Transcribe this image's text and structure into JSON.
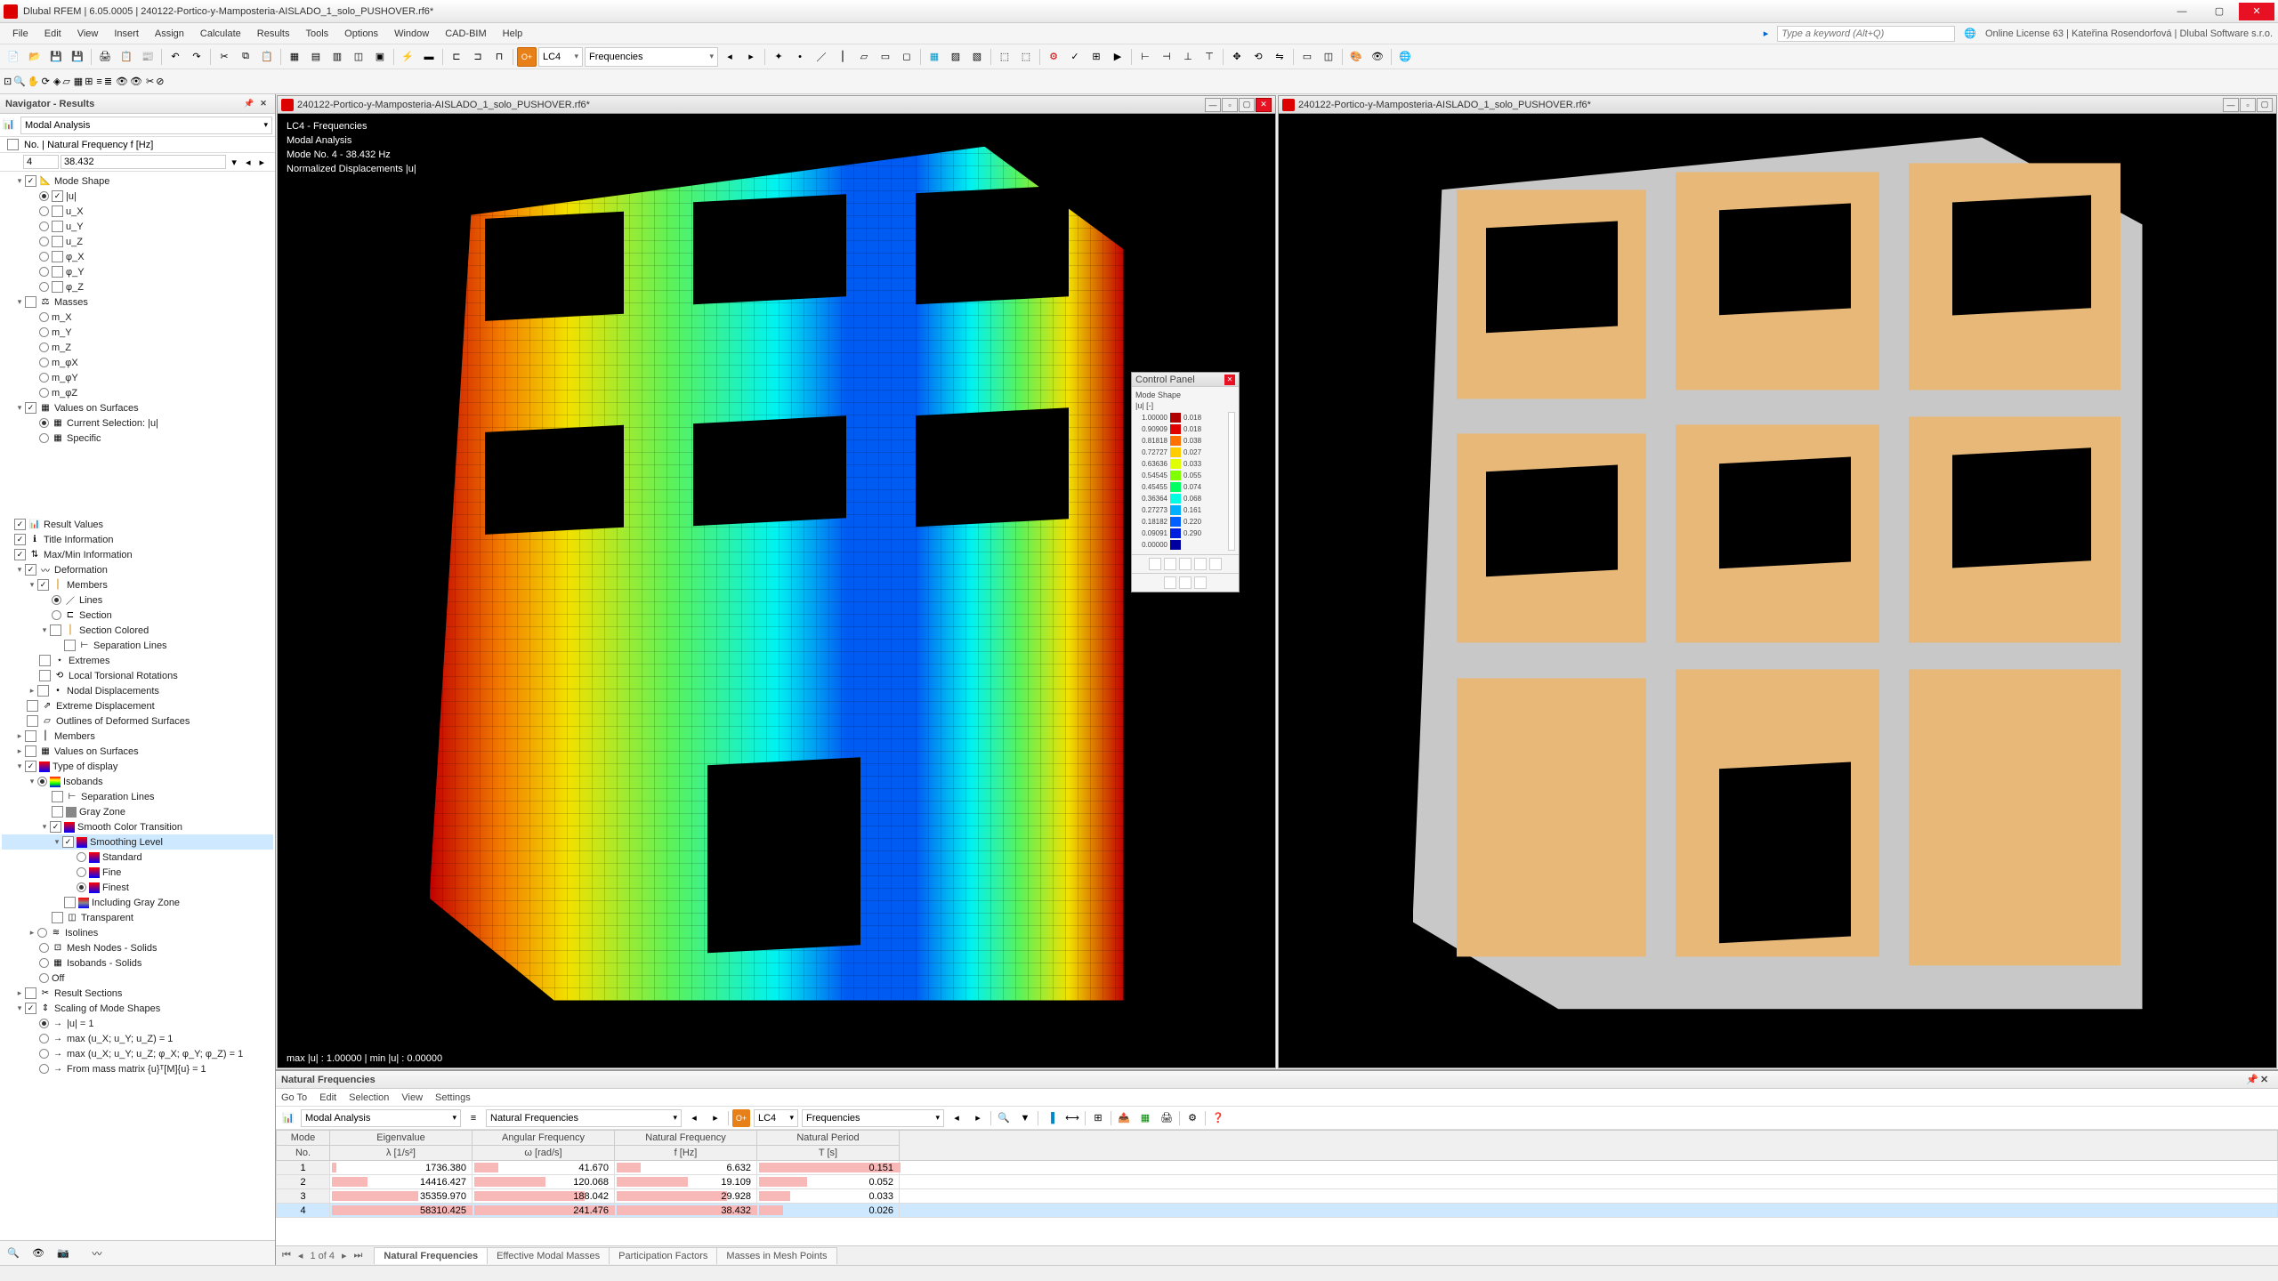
{
  "app": {
    "title": "Dlubal RFEM | 6.05.0005 | 240122-Portico-y-Mamposteria-AISLADO_1_solo_PUSHOVER.rf6*",
    "license": "Online License 63 | Kateřina Rosendorfová | Dlubal Software s.r.o."
  },
  "menus": [
    "File",
    "Edit",
    "View",
    "Insert",
    "Assign",
    "Calculate",
    "Results",
    "Tools",
    "Options",
    "Window",
    "CAD-BIM",
    "Help"
  ],
  "search_placeholder": "Type a keyword (Alt+Q)",
  "toolbar1_combo1": "LC4",
  "toolbar1_combo2": "Frequencies",
  "nav": {
    "title": "Navigator - Results",
    "combo": "Modal Analysis",
    "freq_hdr": "No. | Natural Frequency f [Hz]",
    "freq_no": "4",
    "freq_val": "38.432",
    "mode_shape": "Mode Shape",
    "items_u": [
      "|u|",
      "u_X",
      "u_Y",
      "u_Z",
      "φ_X",
      "φ_Y",
      "φ_Z"
    ],
    "masses": "Masses",
    "items_m": [
      "m_X",
      "m_Y",
      "m_Z",
      "m_φX",
      "m_φY",
      "m_φZ"
    ],
    "values_on_surfaces": "Values on Surfaces",
    "current_selection": "Current Selection: |u|",
    "specific": "Specific",
    "result_values": "Result Values",
    "title_information": "Title Information",
    "maxmin": "Max/Min Information",
    "deformation": "Deformation",
    "members": "Members",
    "lines": "Lines",
    "section": "Section",
    "section_colored": "Section Colored",
    "separation_lines": "Separation Lines",
    "extremes": "Extremes",
    "local_torsional": "Local Torsional Rotations",
    "nodal_disp": "Nodal Displacements",
    "extreme_disp": "Extreme Displacement",
    "outlines_deformed": "Outlines of Deformed Surfaces",
    "members2": "Members",
    "vos2": "Values on Surfaces",
    "type_display": "Type of display",
    "isobands": "Isobands",
    "sep_lines2": "Separation Lines",
    "gray_zone": "Gray Zone",
    "smooth_ct": "Smooth Color Transition",
    "smoothing_level": "Smoothing Level",
    "standard": "Standard",
    "fine": "Fine",
    "finest": "Finest",
    "incl_gray": "Including Gray Zone",
    "transparent": "Transparent",
    "isolines": "Isolines",
    "mesh_nodes_solids": "Mesh Nodes - Solids",
    "isobands_solids": "Isobands - Solids",
    "off": "Off",
    "result_sections": "Result Sections",
    "scaling": "Scaling of Mode Shapes",
    "scale_u1": "|u| = 1",
    "scale_max1": "max (u_X; u_Y; u_Z) = 1",
    "scale_max2": "max (u_X; u_Y; u_Z; φ_X; φ_Y; φ_Z) = 1",
    "scale_mass": "From mass matrix {u}ᵀ[M]{u} = 1"
  },
  "view": {
    "file": "240122-Portico-y-Mamposteria-AISLADO_1_solo_PUSHOVER.rf6*",
    "info1": "LC4 - Frequencies",
    "info2": "Modal Analysis",
    "info3": "Mode No. 4 - 38.432 Hz",
    "info4": "Normalized Displacements |u|",
    "status": "max |u| : 1.00000 | min |u| : 0.00000"
  },
  "ctrl_panel": {
    "title": "Control Panel",
    "sub1": "Mode Shape",
    "sub2": "|u| [-]",
    "rows": [
      {
        "v": "1.00000",
        "c": "#b00000",
        "v2": "0.018"
      },
      {
        "v": "0.90909",
        "c": "#e00000",
        "v2": "0.018"
      },
      {
        "v": "0.81818",
        "c": "#ff7000",
        "v2": "0.038"
      },
      {
        "v": "0.72727",
        "c": "#ffcc00",
        "v2": "0.027"
      },
      {
        "v": "0.63636",
        "c": "#e0ff00",
        "v2": "0.033"
      },
      {
        "v": "0.54545",
        "c": "#80ff00",
        "v2": "0.055"
      },
      {
        "v": "0.45455",
        "c": "#00ff60",
        "v2": "0.074"
      },
      {
        "v": "0.36364",
        "c": "#00ffe0",
        "v2": "0.068"
      },
      {
        "v": "0.27273",
        "c": "#00b0ff",
        "v2": "0.161"
      },
      {
        "v": "0.18182",
        "c": "#0060ff",
        "v2": "0.220"
      },
      {
        "v": "0.09091",
        "c": "#0020e0",
        "v2": "0.290"
      },
      {
        "v": "0.00000",
        "c": "#0000a0",
        "v2": ""
      }
    ]
  },
  "bottom": {
    "title": "Natural Frequencies",
    "menus": [
      "Go To",
      "Edit",
      "Selection",
      "View",
      "Settings"
    ],
    "combo1": "Modal Analysis",
    "combo2": "Natural Frequencies",
    "combo3": "LC4",
    "combo4": "Frequencies",
    "headers": {
      "mode": "Mode",
      "no": "No.",
      "eig": "Eigenvalue",
      "eig_u": "λ [1/s²]",
      "ang": "Angular Frequency",
      "ang_u": "ω [rad/s]",
      "nat": "Natural Frequency",
      "nat_u": "f [Hz]",
      "per": "Natural Period",
      "per_u": "T [s]"
    },
    "rows": [
      {
        "n": "1",
        "eig": "1736.380",
        "ang": "41.670",
        "nat": "6.632",
        "per": "0.151"
      },
      {
        "n": "2",
        "eig": "14416.427",
        "ang": "120.068",
        "nat": "19.109",
        "per": "0.052"
      },
      {
        "n": "3",
        "eig": "35359.970",
        "ang": "188.042",
        "nat": "29.928",
        "per": "0.033"
      },
      {
        "n": "4",
        "eig": "58310.425",
        "ang": "241.476",
        "nat": "38.432",
        "per": "0.026"
      }
    ],
    "page": "1 of 4",
    "tabs": [
      "Natural Frequencies",
      "Effective Modal Masses",
      "Participation Factors",
      "Masses in Mesh Points"
    ]
  }
}
